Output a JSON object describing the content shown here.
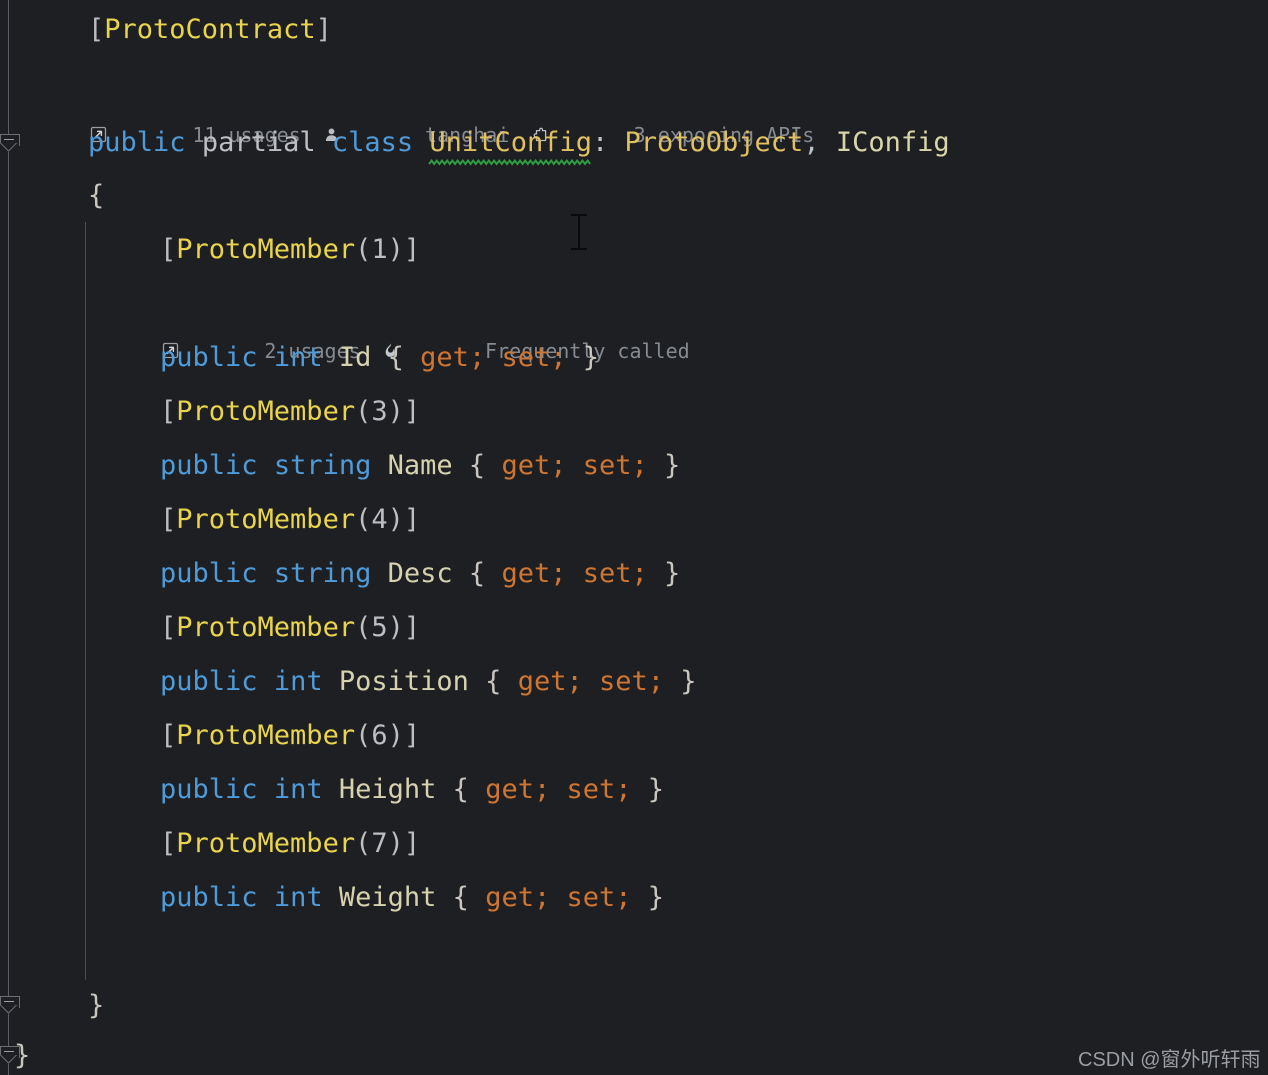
{
  "editor": {
    "background_color": "#1e1f22",
    "default_text_color": "#bcbec4",
    "keyword_color": "#4f9bd9",
    "attribute_color": "#e8d44d",
    "accessor_color": "#cf7532",
    "type_color": "#e0c060",
    "hint_color": "#868a91",
    "error_squiggle_color": "#2ea043"
  },
  "code": {
    "attr_proto_contract": {
      "open_bracket": "[",
      "name": "ProtoContract",
      "close_bracket": "]"
    },
    "class_hint": {
      "usages_icon": "usages-arrow-icon",
      "usages_text": "11 usages",
      "author_icon": "person-icon",
      "author_text": "tanghai",
      "api_icon": "puzzle-piece-icon",
      "api_text": "3 exposing APIs"
    },
    "class_decl": {
      "modifier": "public",
      "partial": "partial",
      "keyword": "class",
      "name": "UnitConfig",
      "colon": ": ",
      "base": "ProtoObject",
      "comma": ", ",
      "interface": "IConfig"
    },
    "open_brace": "{",
    "close_brace_inner": "}",
    "close_brace_outer": "}",
    "member_hint": {
      "usages_icon": "usages-arrow-icon",
      "usages_text": "2 usages",
      "frequent_icon": "flame-icon",
      "frequent_text": "Frequently called"
    },
    "members": [
      {
        "attribute_open": "[",
        "attribute_name": "ProtoMember",
        "attribute_args": "(1)",
        "attribute_close": "]",
        "modifier": "public",
        "type": "int",
        "name": "Id",
        "body_open": "{",
        "getter": "get;",
        "setter": "set;",
        "body_close": "}"
      },
      {
        "attribute_open": "[",
        "attribute_name": "ProtoMember",
        "attribute_args": "(3)",
        "attribute_close": "]",
        "modifier": "public",
        "type": "string",
        "name": "Name",
        "body_open": "{",
        "getter": "get;",
        "setter": "set;",
        "body_close": "}"
      },
      {
        "attribute_open": "[",
        "attribute_name": "ProtoMember",
        "attribute_args": "(4)",
        "attribute_close": "]",
        "modifier": "public",
        "type": "string",
        "name": "Desc",
        "body_open": "{",
        "getter": "get;",
        "setter": "set;",
        "body_close": "}"
      },
      {
        "attribute_open": "[",
        "attribute_name": "ProtoMember",
        "attribute_args": "(5)",
        "attribute_close": "]",
        "modifier": "public",
        "type": "int",
        "name": "Position",
        "body_open": "{",
        "getter": "get;",
        "setter": "set;",
        "body_close": "}"
      },
      {
        "attribute_open": "[",
        "attribute_name": "ProtoMember",
        "attribute_args": "(6)",
        "attribute_close": "]",
        "modifier": "public",
        "type": "int",
        "name": "Height",
        "body_open": "{",
        "getter": "get;",
        "setter": "set;",
        "body_close": "}"
      },
      {
        "attribute_open": "[",
        "attribute_name": "ProtoMember",
        "attribute_args": "(7)",
        "attribute_close": "]",
        "modifier": "public",
        "type": "int",
        "name": "Weight",
        "body_open": "{",
        "getter": "get;",
        "setter": "set;",
        "body_close": "}"
      }
    ]
  },
  "watermark": {
    "text": "CSDN @窗外听轩雨"
  }
}
